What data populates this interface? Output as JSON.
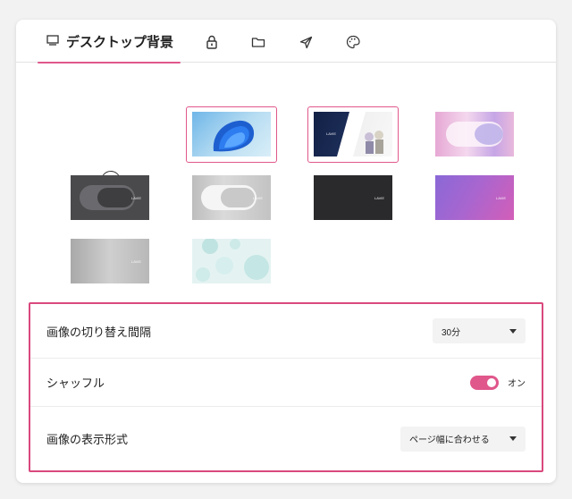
{
  "tabs": {
    "active_label": "デスクトップ背景",
    "icons": [
      "lock-icon",
      "folder-icon",
      "send-icon",
      "palette-icon"
    ]
  },
  "wallpapers": {
    "add_label": "+",
    "items": [
      {
        "name": "windows-bloom",
        "selected": true
      },
      {
        "name": "anime-characters",
        "selected": true
      },
      {
        "name": "pink-purple-gradient",
        "selected": false
      },
      {
        "name": "dark-gray-capsule",
        "selected": false
      },
      {
        "name": "light-gray-capsule",
        "selected": false
      },
      {
        "name": "black-texture",
        "selected": false
      },
      {
        "name": "purple-magenta",
        "selected": false
      },
      {
        "name": "silver-gradient",
        "selected": false
      },
      {
        "name": "mint-bubbles",
        "selected": false
      }
    ],
    "logo_text": "LAVIE"
  },
  "settings": {
    "interval": {
      "label": "画像の切り替え間隔",
      "value": "30分"
    },
    "shuffle": {
      "label": "シャッフル",
      "state": "オン",
      "on": true
    },
    "fit": {
      "label": "画像の表示形式",
      "value": "ページ幅に合わせる"
    }
  },
  "colors": {
    "accent": "#e0578b",
    "highlight_border": "#d9497d"
  }
}
